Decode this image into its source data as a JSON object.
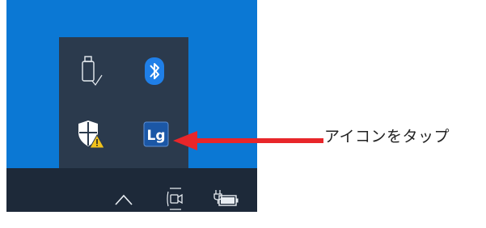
{
  "tray_overflow": {
    "icons": [
      {
        "name": "usb-drive-icon"
      },
      {
        "name": "bluetooth-icon"
      },
      {
        "name": "windows-security-warning-icon"
      },
      {
        "name": "lg-app-icon",
        "label": "Lg"
      }
    ]
  },
  "taskbar": {
    "icons": [
      "show-hidden-icons-chevron-icon",
      "camera-icon",
      "battery-plug-icon"
    ]
  },
  "annotation": {
    "text": "アイコンをタップ",
    "arrow_color": "#e8262a"
  },
  "colors": {
    "desktop": "#0b78d4",
    "popup": "#2b3a4d",
    "taskbar": "#1d2939"
  }
}
